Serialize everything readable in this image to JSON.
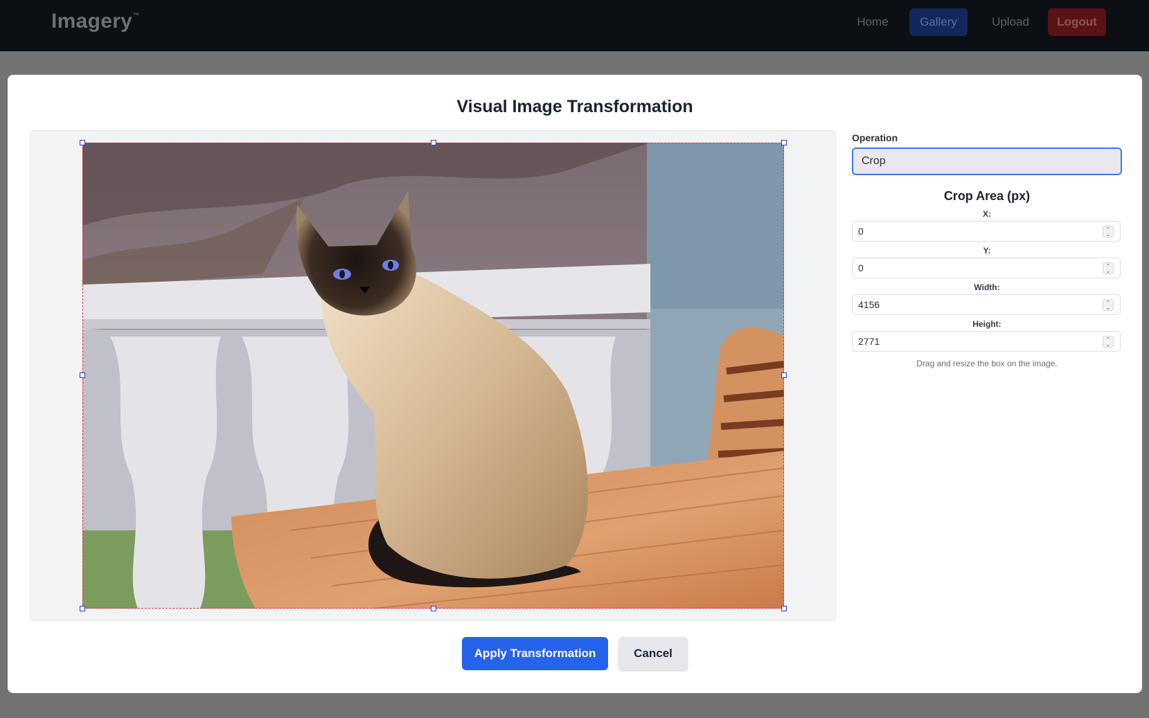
{
  "nav": {
    "brand": "Imagery",
    "brand_mark": "™",
    "links": {
      "home": "Home",
      "gallery": "Gallery",
      "upload": "Upload",
      "logout": "Logout"
    },
    "active": "Gallery"
  },
  "modal": {
    "title": "Visual Image Transformation",
    "operation_label": "Operation",
    "operation_value": "Crop",
    "crop_title": "Crop Area (px)",
    "fields": {
      "x_label": "X:",
      "x_value": "0",
      "y_label": "Y:",
      "y_value": "0",
      "width_label": "Width:",
      "width_value": "4156",
      "height_label": "Height:",
      "height_value": "2771"
    },
    "hint": "Drag and resize the box on the image.",
    "apply_label": "Apply Transformation",
    "cancel_label": "Cancel"
  },
  "colors": {
    "accent": "#2563eb",
    "crop_border": "#e0333a",
    "handle_border": "#2e36c7",
    "navbar_bg": "#0c0f14"
  },
  "icons": {
    "spinner": "number-spinner-icon"
  }
}
